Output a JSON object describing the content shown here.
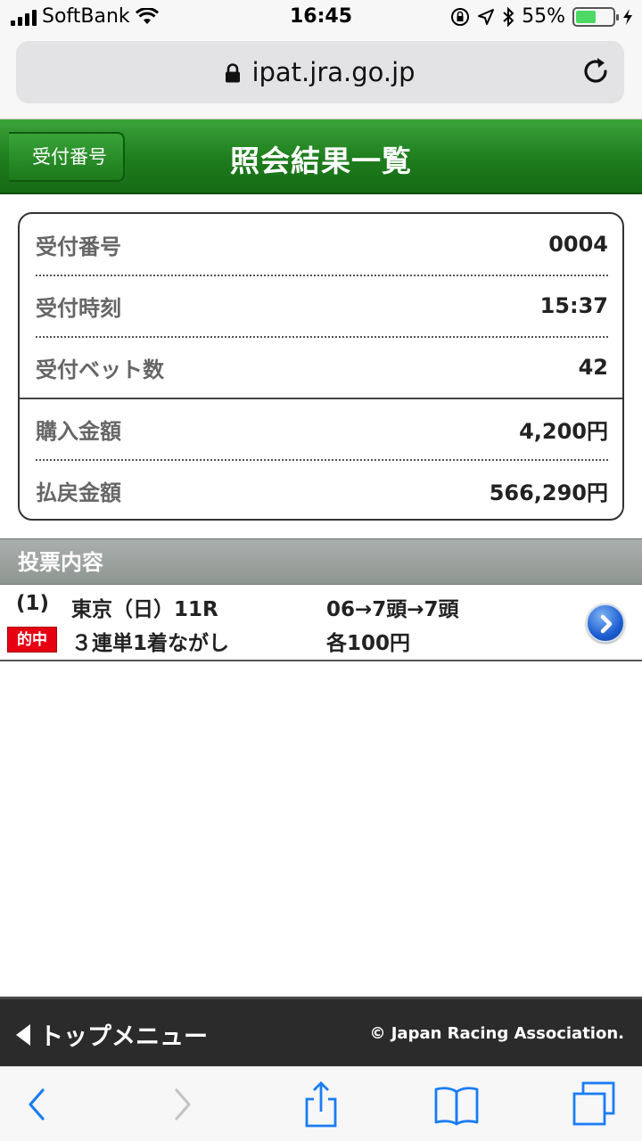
{
  "status_bar": {
    "carrier": "SoftBank",
    "time": "16:45",
    "battery_percent": "55%",
    "battery_level": 0.55
  },
  "browser": {
    "url": "ipat.jra.go.jp"
  },
  "header": {
    "back_label": "受付番号",
    "title": "照会結果一覧"
  },
  "summary": {
    "rows": [
      {
        "label": "受付番号",
        "value": "0004"
      },
      {
        "label": "受付時刻",
        "value": "15:37"
      },
      {
        "label": "受付ベット数",
        "value": "42"
      },
      {
        "label": "購入金額",
        "value": "4,200円"
      },
      {
        "label": "払戻金額",
        "value": "566,290円"
      }
    ]
  },
  "section": {
    "title": "投票内容"
  },
  "bet": {
    "number": "(1)",
    "race": "東京（日）11R",
    "combination": "06→7頭→7頭",
    "result_badge": "的中",
    "bet_type": "３連単1着ながし",
    "amount": "各100円"
  },
  "footer": {
    "top_menu": "トップメニュー",
    "copyright": "© Japan Racing Association."
  },
  "colors": {
    "header_green": "#1e7d1d",
    "hit_red": "#e60012",
    "ios_blue": "#1a7cf5"
  }
}
